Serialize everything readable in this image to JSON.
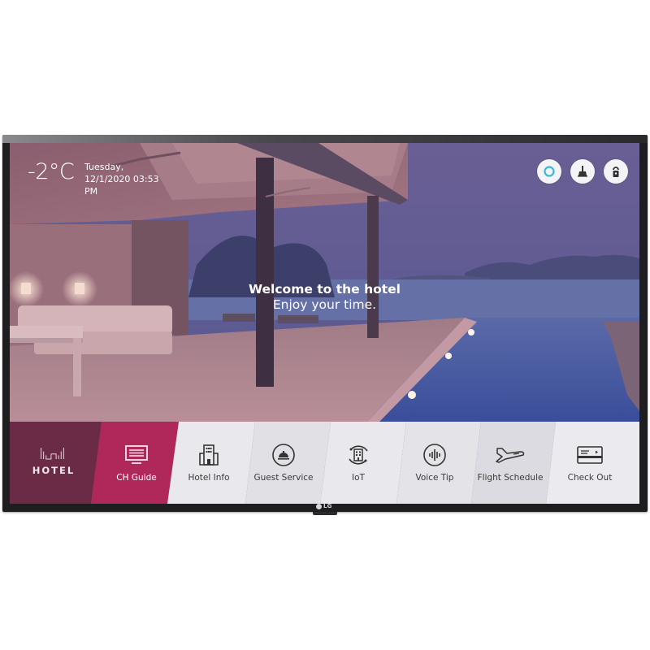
{
  "device": {
    "brand_logo": "LG"
  },
  "status": {
    "temperature": "-2°C",
    "day": "Tuesday,",
    "datetime_line": "12/1/2020 03:53",
    "ampm": "PM"
  },
  "welcome": {
    "title": "Welcome to the hotel",
    "subtitle": "Enjoy your time."
  },
  "top_icons": [
    {
      "name": "alexa-icon",
      "color": "#3eb6d8"
    },
    {
      "name": "housekeeping-broom-icon",
      "color": "#333333"
    },
    {
      "name": "do-not-disturb-door-hanger-icon",
      "color": "#333333"
    }
  ],
  "menu": {
    "brand_label": "HOTEL",
    "active_color": "#b0285a",
    "brand_color": "#6b2a45",
    "items": [
      {
        "label": "CH Guide",
        "icon": "tv-guide-icon",
        "active": true
      },
      {
        "label": "Hotel Info",
        "icon": "hotel-building-icon",
        "active": false
      },
      {
        "label": "Guest Service",
        "icon": "service-bell-icon",
        "active": false
      },
      {
        "label": "IoT",
        "icon": "iot-device-icon",
        "active": false
      },
      {
        "label": "Voice Tip",
        "icon": "voice-waveform-icon",
        "active": false
      },
      {
        "label": "Flight Schedule",
        "icon": "airplane-icon",
        "active": false
      },
      {
        "label": "Check Out",
        "icon": "credit-card-icon",
        "active": false
      }
    ]
  }
}
